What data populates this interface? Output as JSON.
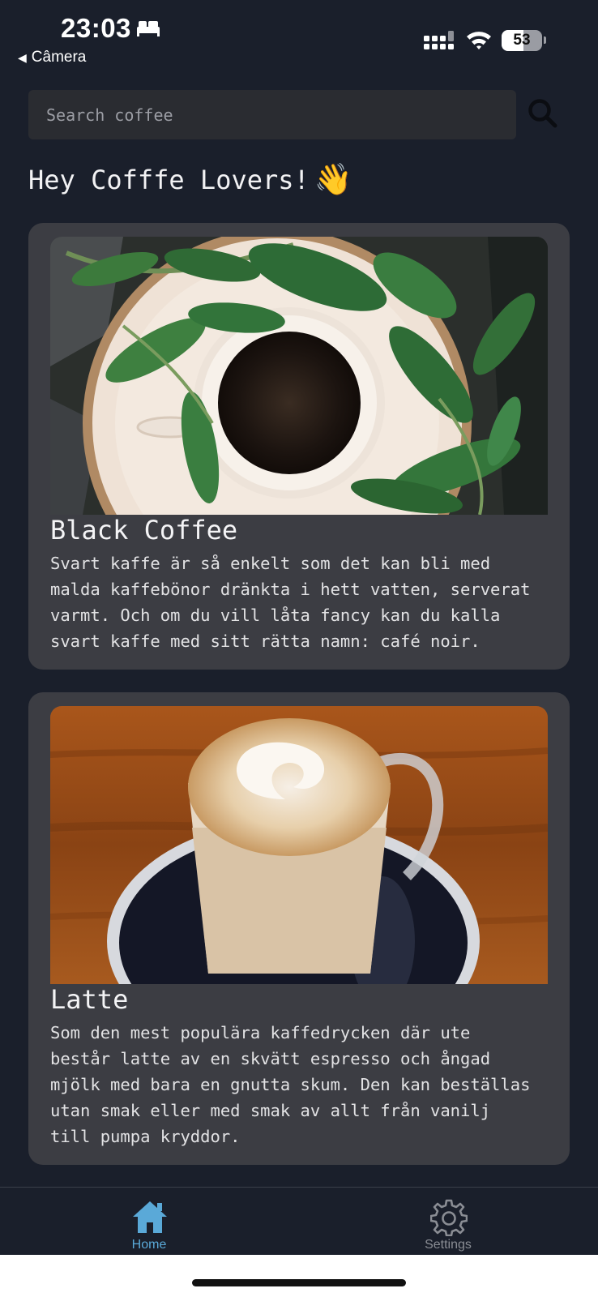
{
  "status": {
    "time": "23:03",
    "back_label": "Câmera",
    "battery": "53",
    "battery_level": 0.53
  },
  "search": {
    "placeholder": "Search coffee"
  },
  "greeting": {
    "text": "Hey Cofffe Lovers!",
    "emoji": "👋"
  },
  "cards": [
    {
      "title": "Black Coffee",
      "description": "Svart kaffe är så enkelt som det kan bli med\nmalda kaffebönor dränkta i hett vatten, serverat\nvarmt. Och om du vill låta fancy kan du kalla\nsvart kaffe med sitt rätta namn: café noir."
    },
    {
      "title": "Latte",
      "description": "Som den mest populära kaffedrycken där ute\nbestår latte av en skvätt espresso och ångad\nmjölk med bara en gnutta skum. Den kan beställas\nutan smak eller med smak av allt från vanilj\ntill pumpa kryddor."
    }
  ],
  "tabs": [
    {
      "label": "Home",
      "icon": "home-icon",
      "active": true
    },
    {
      "label": "Settings",
      "icon": "gear-icon",
      "active": false
    }
  ],
  "colors": {
    "background": "#1a1f2b",
    "card": "#3c3d43",
    "accent": "#5aa9d8",
    "inactive": "#8a8d94"
  }
}
